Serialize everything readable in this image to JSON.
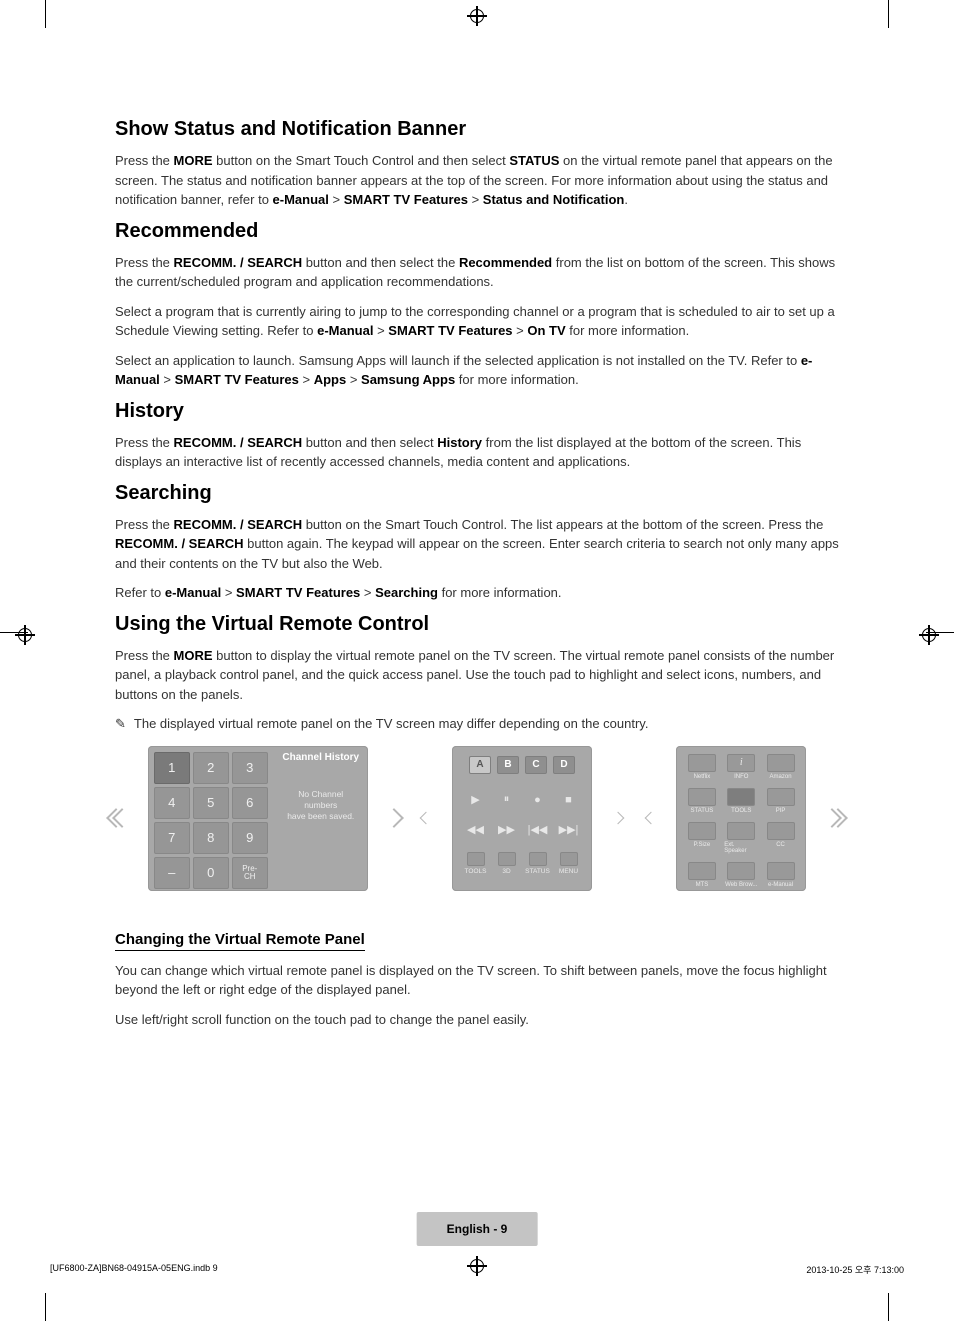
{
  "sections": {
    "status": {
      "heading": "Show Status and Notification Banner",
      "p1_a": "Press the ",
      "p1_more": "MORE",
      "p1_b": " button on the Smart Touch Control and then select ",
      "p1_status": "STATUS",
      "p1_c": " on the virtual remote panel that appears on the screen. The status and notification banner appears at the top of the screen. For more information about using the status and notification banner, refer to ",
      "p1_emanual": "e-Manual",
      "p1_gt1": " > ",
      "p1_smart": "SMART TV Features",
      "p1_gt2": " > ",
      "p1_sn": "Status and Notification",
      "p1_end": "."
    },
    "recommended": {
      "heading": "Recommended",
      "p1_a": "Press the ",
      "p1_btn": "RECOMM. / SEARCH",
      "p1_b": " button and then select the ",
      "p1_rec": "Recommended",
      "p1_c": " from the list on bottom of the screen. This shows the current/scheduled program and application recommendations.",
      "p2_a": "Select a program that is currently airing to jump to the corresponding channel or a program that is scheduled to air to set up a Schedule Viewing setting. Refer to ",
      "p2_emanual": "e-Manual",
      "p2_gt1": " > ",
      "p2_smart": "SMART TV Features",
      "p2_gt2": " > ",
      "p2_ontv": "On TV",
      "p2_b": " for more information.",
      "p3_a": "Select an application to launch. Samsung Apps will launch if the selected application is not installed on the TV. Refer to ",
      "p3_emanual": "e-Manual",
      "p3_gt1": " > ",
      "p3_smart": "SMART TV Features",
      "p3_gt2": " > ",
      "p3_apps": "Apps",
      "p3_gt3": " > ",
      "p3_samsung": "Samsung Apps",
      "p3_b": " for more information."
    },
    "history": {
      "heading": "History",
      "p1_a": "Press the ",
      "p1_btn": "RECOMM. / SEARCH",
      "p1_b": " button and then select ",
      "p1_hist": "History",
      "p1_c": " from the list displayed at the bottom of the screen. This displays an interactive list of recently accessed channels, media content and applications."
    },
    "searching": {
      "heading": "Searching",
      "p1_a": "Press the ",
      "p1_btn1": "RECOMM. / SEARCH",
      "p1_b": " button on the Smart Touch Control. The list appears at the bottom of the screen. Press the ",
      "p1_btn2": "RECOMM. / SEARCH",
      "p1_c": " button again. The keypad will appear on the screen. Enter search criteria to search not only many apps and their contents on the TV but also the Web.",
      "p2_a": "Refer to ",
      "p2_emanual": "e-Manual",
      "p2_gt1": " > ",
      "p2_smart": "SMART TV Features",
      "p2_gt2": " > ",
      "p2_search": "Searching",
      "p2_b": " for more information."
    },
    "virtual": {
      "heading": "Using the Virtual Remote Control",
      "p1_a": "Press the ",
      "p1_more": "MORE",
      "p1_b": " button to display the virtual remote panel on the TV screen. The virtual remote panel consists of the number panel, a playback control panel, and the quick access panel. Use the touch pad to highlight and select icons, numbers, and buttons on the panels.",
      "note_icon": "✎",
      "note": "The displayed virtual remote panel on the TV screen may differ depending on the country."
    },
    "changing": {
      "heading": "Changing the Virtual Remote Panel",
      "p1": "You can change which virtual remote panel is displayed on the TV screen. To shift between panels, move the focus highlight beyond the left or right edge of the displayed panel.",
      "p2": "Use left/right scroll function on the touch pad to change the panel easily."
    }
  },
  "panels": {
    "keypad": [
      "1",
      "2",
      "3",
      "4",
      "5",
      "6",
      "7",
      "8",
      "9",
      "–",
      "0"
    ],
    "prech": "Pre-\nCH",
    "ch_title": "Channel History",
    "ch_msg1": "No Channel numbers",
    "ch_msg2": "have been saved.",
    "abcd": [
      "A",
      "B",
      "C",
      "D"
    ],
    "bottom_play": [
      "TOOLS",
      "3D",
      "STATUS",
      "MENU"
    ],
    "apps": [
      [
        "Netflix",
        "INFO",
        "Amazon"
      ],
      [
        "STATUS",
        "TOOLS",
        "PIP"
      ],
      [
        "P.Size",
        "Ext. Speaker",
        "CC"
      ],
      [
        "MTS",
        "Web Brow...",
        "e-Manual"
      ]
    ],
    "info_glyph": "i"
  },
  "footer": {
    "page": "English - 9",
    "left": "[UF6800-ZA]BN68-04915A-05ENG.indb   9",
    "right": "2013-10-25   오후 7:13:00"
  }
}
